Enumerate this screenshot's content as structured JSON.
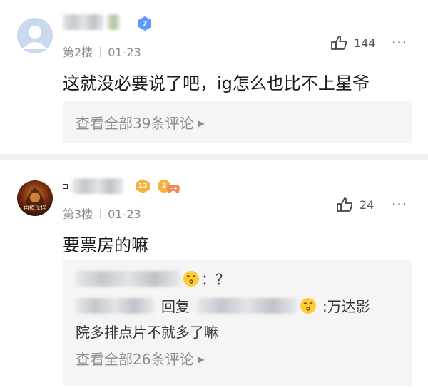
{
  "posts": [
    {
      "floor": "第2楼",
      "date": "01-23",
      "likes": "144",
      "content": "这就没必要说了吧，ig怎么也比不上星爷",
      "view_all": "查看全部39条评论",
      "badge_level": "7"
    },
    {
      "floor": "第3楼",
      "date": "01-23",
      "likes": "24",
      "content": "要票房的嘛",
      "view_all": "查看全部26条评论",
      "badge_level": "13",
      "badge_level2": "2",
      "avatar_text": "再揽伙伴",
      "replies": [
        {
          "suffix": "：？"
        },
        {
          "action": "回复",
          "suffix": ":万达影",
          "cont": "院多排点片不就多了嘛"
        }
      ]
    }
  ],
  "more_icon": "···",
  "colors": {
    "badge_blue": "#5b9bff",
    "badge_gold": "#f4b33c",
    "meta": "#8a8a8a"
  }
}
